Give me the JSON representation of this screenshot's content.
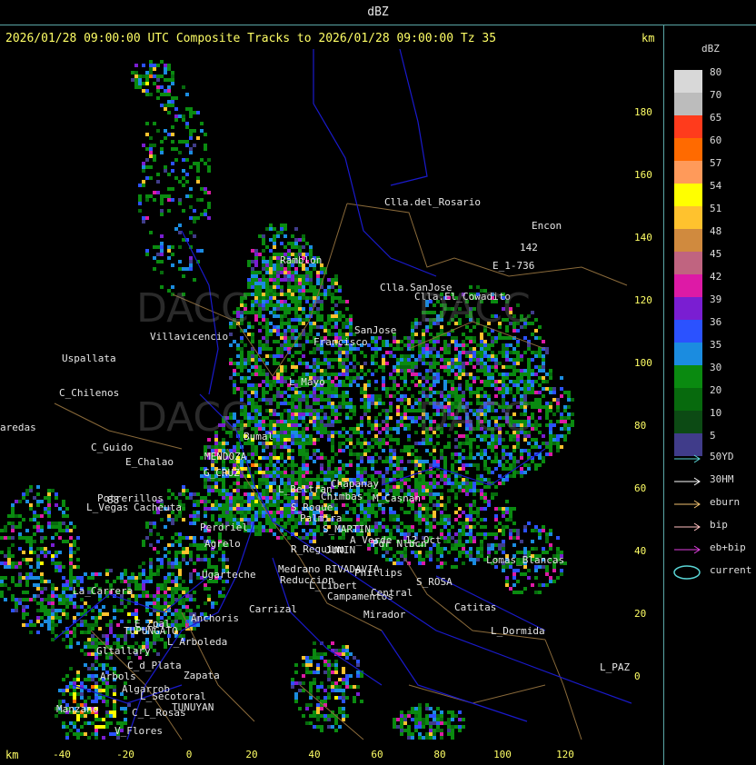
{
  "header": {
    "title": "dBZ",
    "subtitle": "2026/01/28 09:00:00 UTC Composite Tracks to 2026/01/28 09:00:00 Tz 35",
    "km_top": "km",
    "km_bottom": "km"
  },
  "axes": {
    "y_ticks": [
      "180",
      "160",
      "140",
      "120",
      "100",
      "80",
      "60",
      "40",
      "20",
      "0"
    ],
    "x_ticks": [
      "-40",
      "-20",
      "0",
      "20",
      "40",
      "60",
      "80",
      "100",
      "120"
    ]
  },
  "legend": {
    "title": "dBZ",
    "scale": [
      {
        "value": "80",
        "color": "#d8d8d8"
      },
      {
        "value": "70",
        "color": "#bcbcbc"
      },
      {
        "value": "65",
        "color": "#ff3b1c"
      },
      {
        "value": "60",
        "color": "#ff6a00"
      },
      {
        "value": "57",
        "color": "#ff9a5a"
      },
      {
        "value": "54",
        "color": "#ffff00"
      },
      {
        "value": "51",
        "color": "#ffc22e"
      },
      {
        "value": "48",
        "color": "#d08a3e"
      },
      {
        "value": "45",
        "color": "#c06480"
      },
      {
        "value": "42",
        "color": "#dd1aa6"
      },
      {
        "value": "39",
        "color": "#7a1ed2"
      },
      {
        "value": "36",
        "color": "#2b52ff"
      },
      {
        "value": "35",
        "color": "#1b8ce0"
      },
      {
        "value": "30",
        "color": "#0a8a10"
      },
      {
        "value": "20",
        "color": "#076a0d"
      },
      {
        "value": "10",
        "color": "#0c4a14"
      },
      {
        "value": "5",
        "color": "#403c8a"
      }
    ],
    "tracks": [
      {
        "label": "50YD",
        "color": "#5ad6d6"
      },
      {
        "label": "30HM",
        "color": "#ffffff"
      },
      {
        "label": "eburn",
        "color": "#f0c070"
      },
      {
        "label": "bip",
        "color": "#ffc0c0"
      },
      {
        "label": "eb+bip",
        "color": "#e040e0"
      },
      {
        "label": "current",
        "color": "#5ad6d6"
      }
    ]
  },
  "places": [
    "Clla.del_Rosario",
    "Encon",
    "142",
    "E_1-736",
    "Ramblon",
    "Clla.SanJose",
    "Clla.El_Cowadito",
    "Villavicencio",
    "Uspallata",
    "SanJose",
    "Francisco",
    "C_Chilenos",
    "L_Mayo",
    "aredas",
    "Bumal",
    "C_Guido",
    "E_Chalao",
    "MENDOZA",
    "G_CRUZ",
    "L_Beltran",
    "Chimbas",
    "Chapanay",
    "M_Casnan",
    "Potrerillos",
    "L_Vegas",
    "Cacheuta",
    "S_Roque",
    "Palmira",
    "S_MARTIN",
    "Perdriel",
    "Agrelo",
    "A_Verde",
    "R_Reguinn",
    "JUNIN",
    "Pdr Nlbcn",
    "12_Oct",
    "Lomas_Blancas",
    "Ugarteche",
    "Medrano",
    "RIVADAVIA",
    "Phillips",
    "Reduccion",
    "S_ROSA",
    "L_Libert",
    "Campamentos",
    "Central",
    "La_Carrera",
    "Catitas",
    "TUPUNGATO",
    "Anchoris",
    "Carrizal",
    "Mirador",
    "L_Dormida",
    "E_Zpal",
    "Gltallary",
    "L_Arboleda",
    "C_d_Plata",
    "Arbols",
    "Zapata",
    "Algarrob",
    "L_Secotoral",
    "TUNUYAN",
    "C_L_Rosas",
    "Manzano",
    "V_Flores",
    "L_PAZ",
    "88"
  ],
  "watermark": "DACC"
}
